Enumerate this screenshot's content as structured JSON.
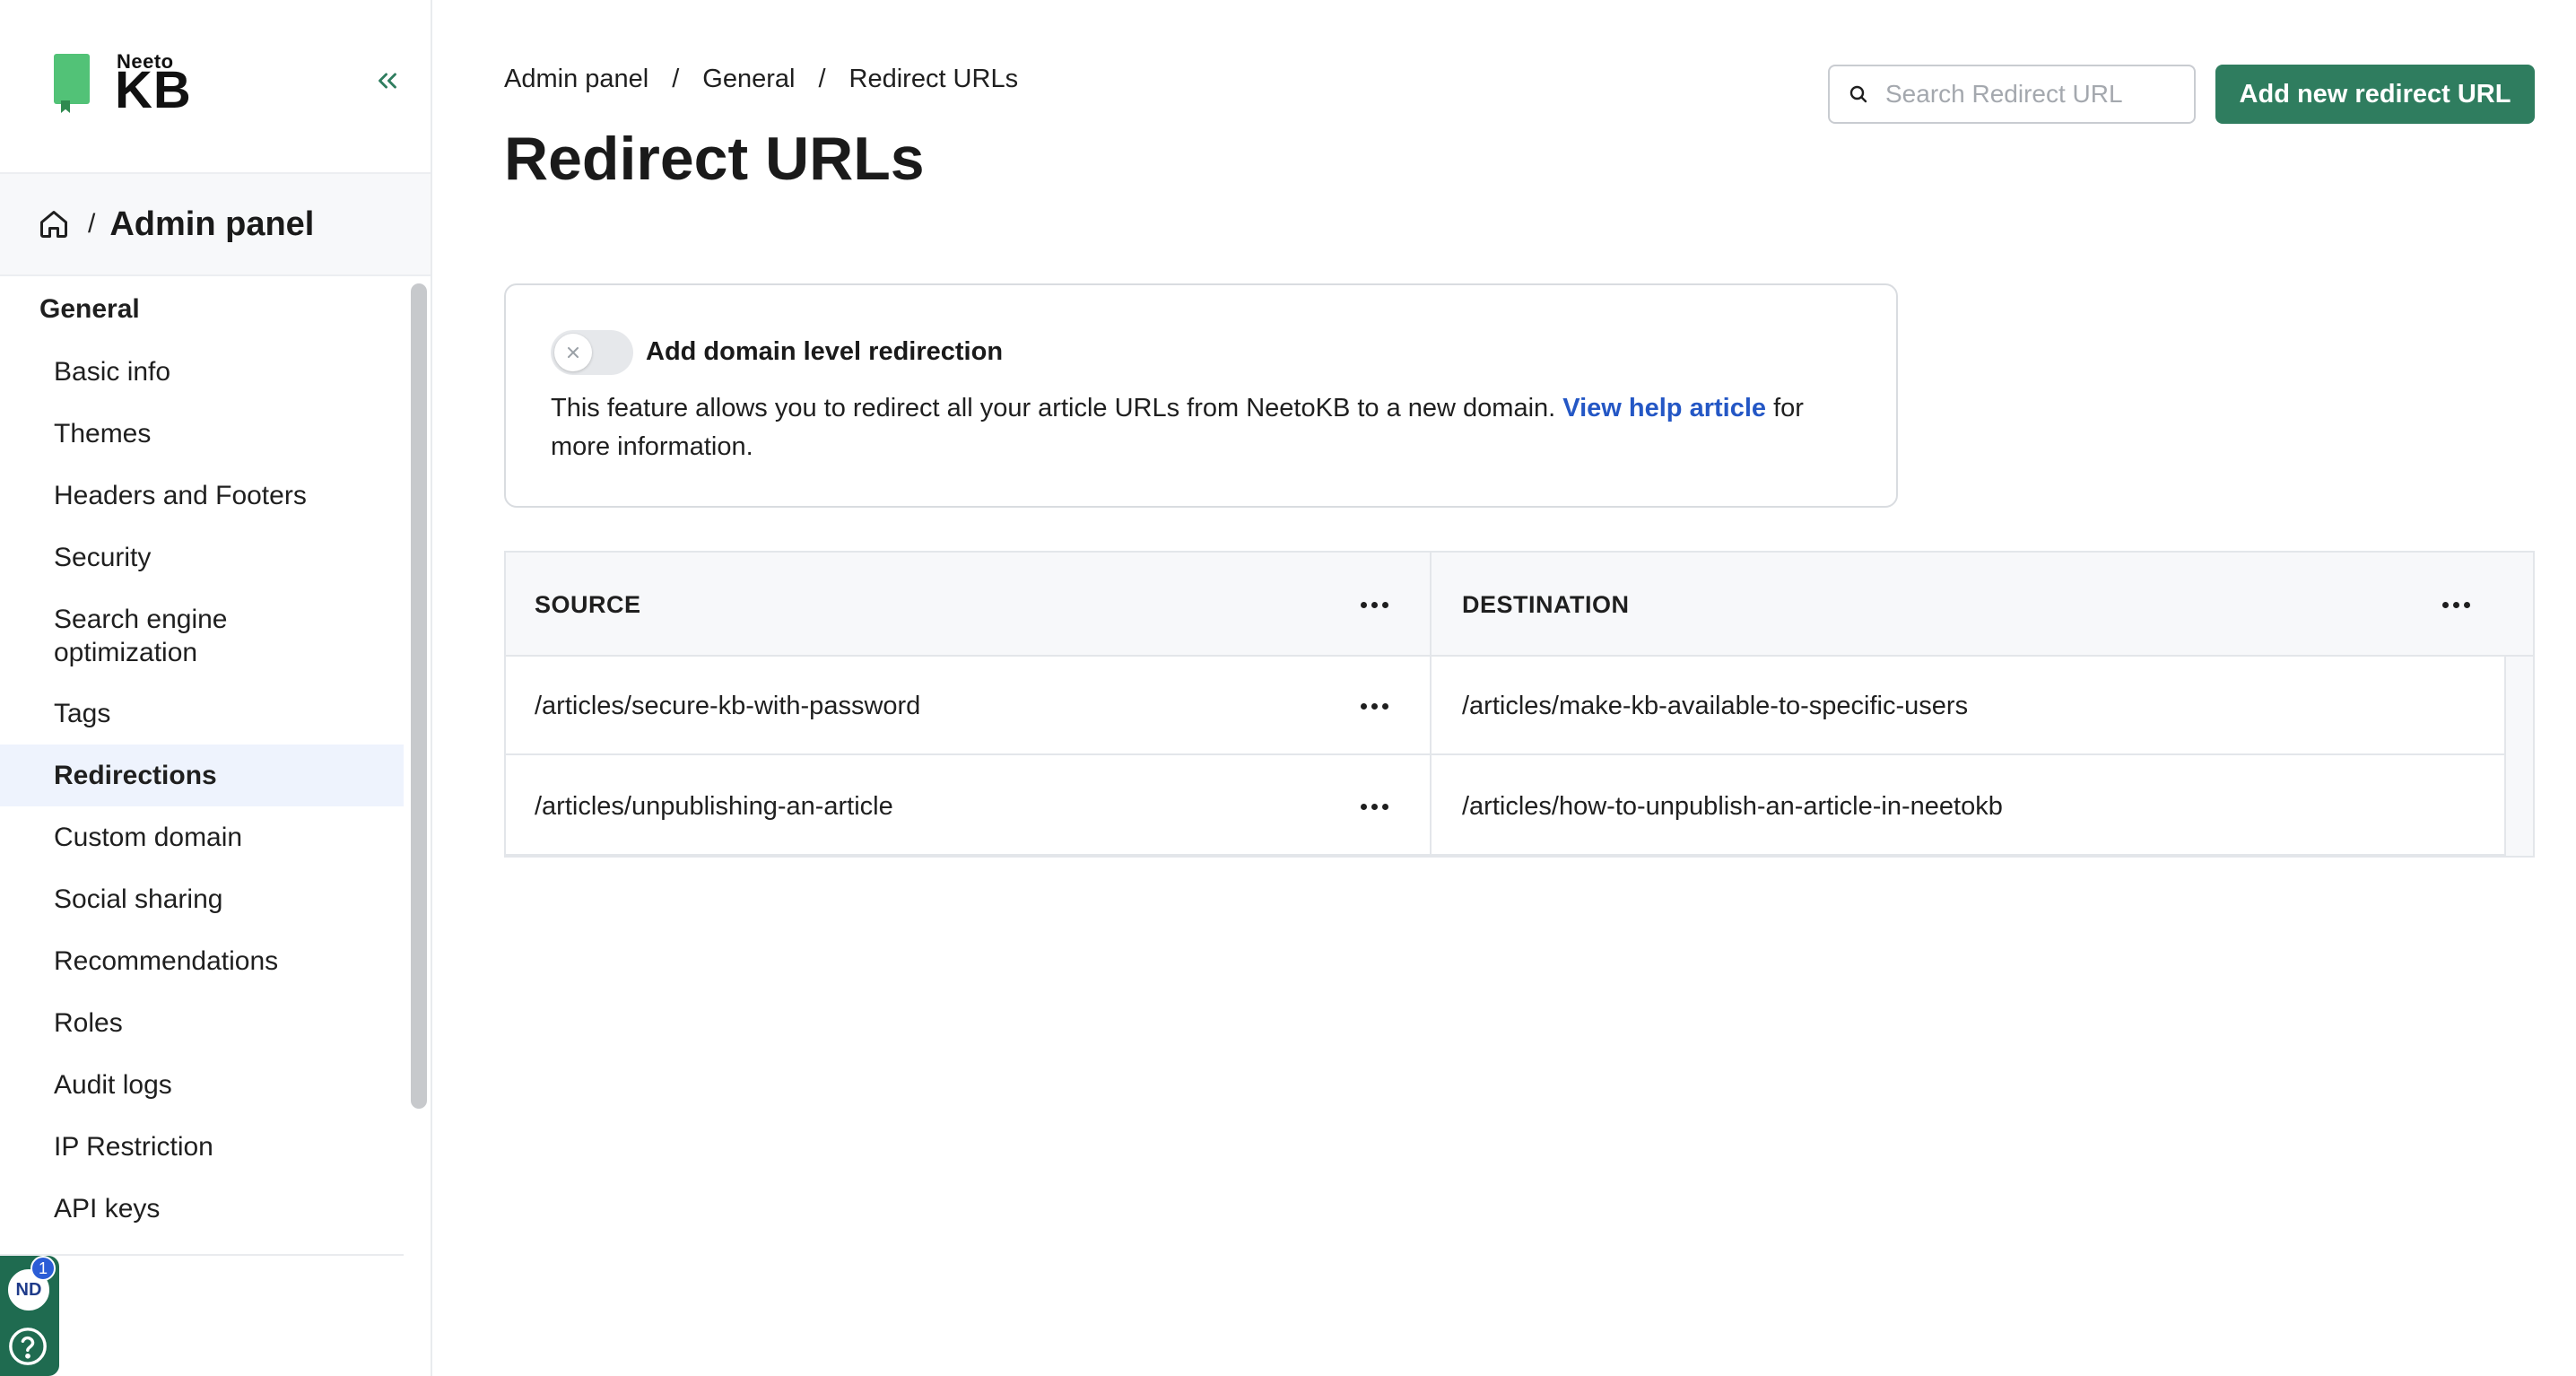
{
  "app": {
    "brand_small": "Neeto",
    "brand_big": "KB"
  },
  "sidebar": {
    "header_title": "Admin panel",
    "header_separator": "/",
    "group_label": "General",
    "items": [
      {
        "label": "Basic info",
        "active": false
      },
      {
        "label": "Themes",
        "active": false
      },
      {
        "label": "Headers and Footers",
        "active": false
      },
      {
        "label": "Security",
        "active": false
      },
      {
        "label": "Search engine optimization",
        "active": false
      },
      {
        "label": "Tags",
        "active": false
      },
      {
        "label": "Redirections",
        "active": true
      },
      {
        "label": "Custom domain",
        "active": false
      },
      {
        "label": "Social sharing",
        "active": false
      },
      {
        "label": "Recommendations",
        "active": false
      },
      {
        "label": "Roles",
        "active": false
      },
      {
        "label": "Audit logs",
        "active": false
      },
      {
        "label": "IP Restriction",
        "active": false
      },
      {
        "label": "API keys",
        "active": false
      }
    ],
    "avatar_initials": "ND",
    "notification_count": "1"
  },
  "breadcrumb": {
    "items": [
      "Admin panel",
      "General",
      "Redirect URLs"
    ],
    "separator": "/"
  },
  "page": {
    "title": "Redirect URLs"
  },
  "search": {
    "placeholder": "Search Redirect URL",
    "value": ""
  },
  "actions": {
    "add_label": "Add new redirect URL"
  },
  "domain_redirection": {
    "toggle_on": false,
    "title": "Add domain level redirection",
    "description_before": "This feature allows you to redirect all your article URLs from NeetoKB to a new domain. ",
    "link_text": "View help article",
    "description_after": " for more information."
  },
  "table": {
    "columns": [
      "SOURCE",
      "DESTINATION"
    ],
    "rows": [
      {
        "source": "/articles/secure-kb-with-password",
        "destination": "/articles/make-kb-available-to-specific-users"
      },
      {
        "source": "/articles/unpublishing-an-article",
        "destination": "/articles/how-to-unpublish-an-article-in-neetokb"
      }
    ]
  },
  "colors": {
    "primary": "#2f7d5f",
    "link": "#2457c5",
    "active_nav_bg": "#eef3fd",
    "brand_green": "#52c277"
  },
  "icons": {
    "collapse": "chevrons-left-icon",
    "home": "home-icon",
    "search": "search-icon",
    "toggle_off": "x-icon",
    "menu": "more-horizontal-icon",
    "help": "help-circle-icon"
  }
}
